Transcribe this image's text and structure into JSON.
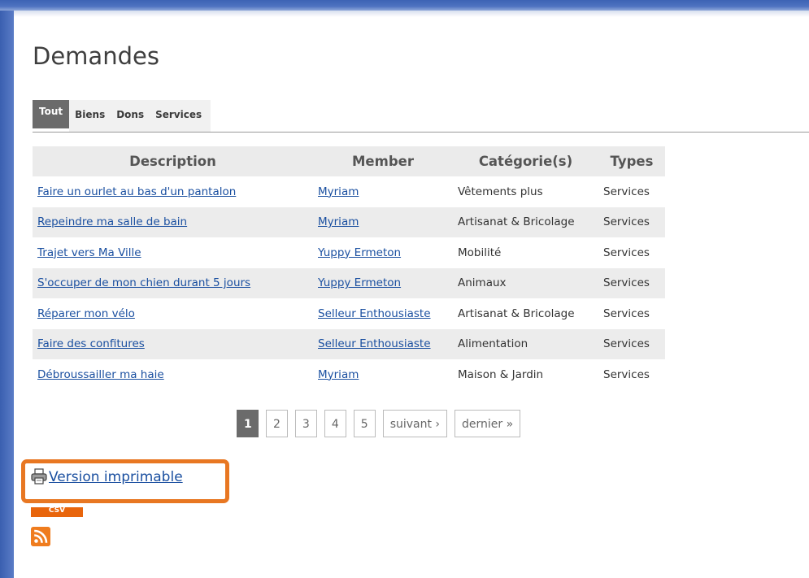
{
  "page": {
    "title": "Demandes"
  },
  "tabs": [
    {
      "label": "Tout",
      "active": true
    },
    {
      "label": "Biens",
      "active": false
    },
    {
      "label": "Dons",
      "active": false
    },
    {
      "label": "Services",
      "active": false
    }
  ],
  "table": {
    "headers": [
      "Description",
      "Member",
      "Catégorie(s)",
      "Types"
    ],
    "rows": [
      {
        "description": "Faire un ourlet au bas d'un pantalon",
        "member": "Myriam",
        "category": "Vêtements plus",
        "type": "Services"
      },
      {
        "description": "Repeindre ma salle de bain",
        "member": "Myriam",
        "category": "Artisanat & Bricolage",
        "type": "Services"
      },
      {
        "description": "Trajet vers Ma Ville",
        "member": "Yuppy Ermeton",
        "category": "Mobilité",
        "type": "Services"
      },
      {
        "description": "S'occuper de mon chien durant 5 jours",
        "member": "Yuppy Ermeton",
        "category": "Animaux",
        "type": "Services"
      },
      {
        "description": "Réparer mon vélo",
        "member": "Selleur Enthousiaste",
        "category": "Artisanat & Bricolage",
        "type": "Services"
      },
      {
        "description": "Faire des confitures",
        "member": "Selleur Enthousiaste",
        "category": "Alimentation",
        "type": "Services"
      },
      {
        "description": "Débroussailler ma haie",
        "member": "Myriam",
        "category": "Maison & Jardin",
        "type": "Services"
      }
    ]
  },
  "pager": {
    "current": "1",
    "pages": [
      "2",
      "3",
      "4",
      "5"
    ],
    "next": "suivant ›",
    "last": "dernier »"
  },
  "footer": {
    "print_label": "Version imprimable",
    "csv_label": "CSV",
    "print_icon": "printer-icon",
    "rss_icon": "rss-icon"
  },
  "colors": {
    "accent_highlight": "#e87722",
    "link": "#1a4fa0",
    "active_tab": "#6b6b6b"
  }
}
